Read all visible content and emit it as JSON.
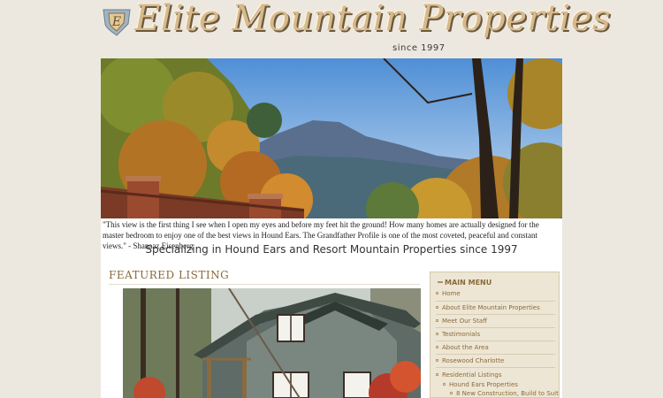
{
  "header": {
    "logo_text": "Elite Mountain Properties",
    "since_text": "since 1997"
  },
  "hero": {
    "caption": "\"This view is the first thing I see when I open my eyes and before my feet hit the ground! How many homes are actually designed for the master bedroom to enjoy one of the best views in Hound Ears. The Grandfather Profile is one of the most coveted, peaceful and constant views.\" - Shanaaz Eisenberg"
  },
  "tagline": "Specializing in Hound Ears and Resort Mountain Properties since 1997",
  "featured": {
    "title": "FEATURED LISTING"
  },
  "menu": {
    "title": "MAIN MENU",
    "items": [
      {
        "label": "Home"
      },
      {
        "label": "About Elite Mountain Properties"
      },
      {
        "label": "Meet Our Staff"
      },
      {
        "label": "Testimonials"
      },
      {
        "label": "About the Area"
      },
      {
        "label": "Rosewood Charlotte"
      },
      {
        "label": "Residential Listings"
      },
      {
        "label": "Hound Ears Properties"
      },
      {
        "label": "8 New Construction, Build to Suit"
      }
    ]
  },
  "colors": {
    "background": "#ede8df",
    "accent": "#8b6a3a",
    "logo_gold": "#d7b98b"
  }
}
